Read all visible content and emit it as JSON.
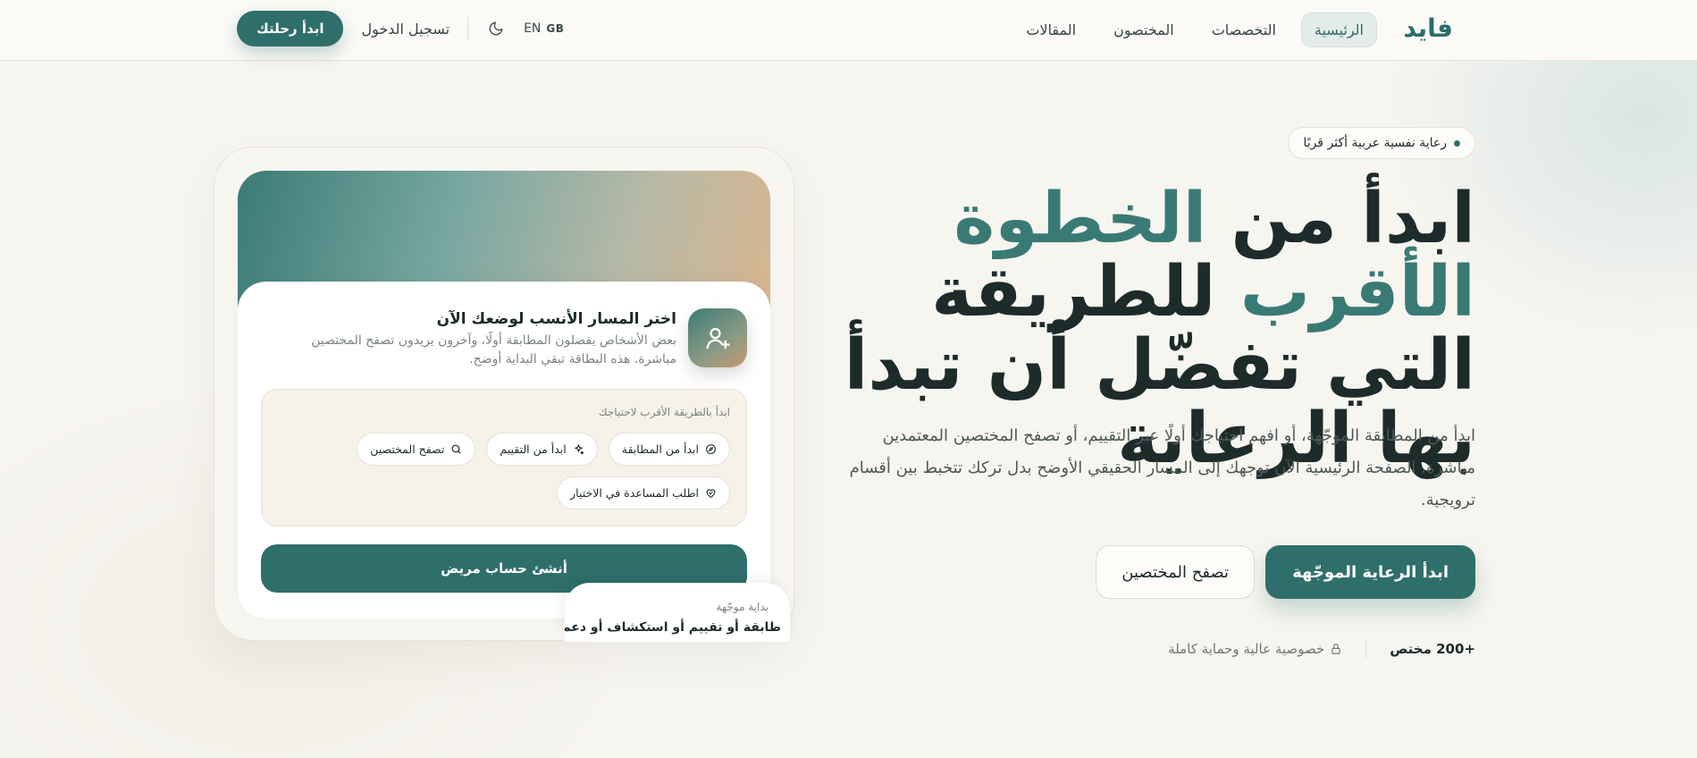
{
  "header": {
    "logo": "فايد",
    "nav": [
      {
        "label": "الرئيسية",
        "active": true
      },
      {
        "label": "التخصصات",
        "active": false
      },
      {
        "label": "المختصون",
        "active": false
      },
      {
        "label": "المقالات",
        "active": false
      }
    ],
    "start_button": "ابدأ رحلتك",
    "login": "تسجيل الدخول",
    "theme_icon": "moon-icon",
    "lang_en": "EN",
    "lang_gb": "GB"
  },
  "hero": {
    "tagline": "رعاية نفسية عربية أكثر قربًا",
    "headline_part1": "ابدأ من ",
    "headline_accent": "الخطوة الأقرب",
    "headline_part2": "للطريقة التي تفضّل أن تبدأ بها الرعاية",
    "description": "ابدأ من المطابقة الموجّهة، أو افهم احتياجك أولًا عبر التقييم، أو تصفح المختصين المعتمدين مباشرة. الصفحة الرئيسية الآن توجهك إلى المسار الحقيقي الأوضح بدل تركك تتخبط بين أقسام ترويجية.",
    "primary_cta": "ابدأ الرعاية الموجّهة",
    "secondary_cta": "تصفح المختصين",
    "stat_count": "+200 مختص",
    "stat_privacy": "خصوصية عالية وحماية كاملة"
  },
  "card": {
    "title": "اختر المسار الأنسب لوضعك الآن",
    "subtitle": "بعض الأشخاص يفضلون المطابقة أولًا، وآخرون يريدون تصفح المختصين مباشرة. هذه البطاقة تبقي البداية أوضح.",
    "choice_label": "ابدأ بالطريقة الأقرب لاحتياجك",
    "chips": [
      {
        "label": "ابدأ من المطابقة",
        "icon": "compass-icon"
      },
      {
        "label": "ابدأ من التقييم",
        "icon": "sparkle-icon"
      },
      {
        "label": "تصفح المختصين",
        "icon": "search-icon"
      },
      {
        "label": "اطلب المساعدة في الاختيار",
        "icon": "heart-icon"
      }
    ],
    "create_button": "أنشئ حساب مريض",
    "note_label": "بداية موجّهة",
    "note_text": "طابقة أو تقييم أو استكشاف أو دعم"
  },
  "colors": {
    "brand": "#2f6f6b",
    "accent_text": "#3a7a74",
    "background": "#f7f5f0"
  }
}
